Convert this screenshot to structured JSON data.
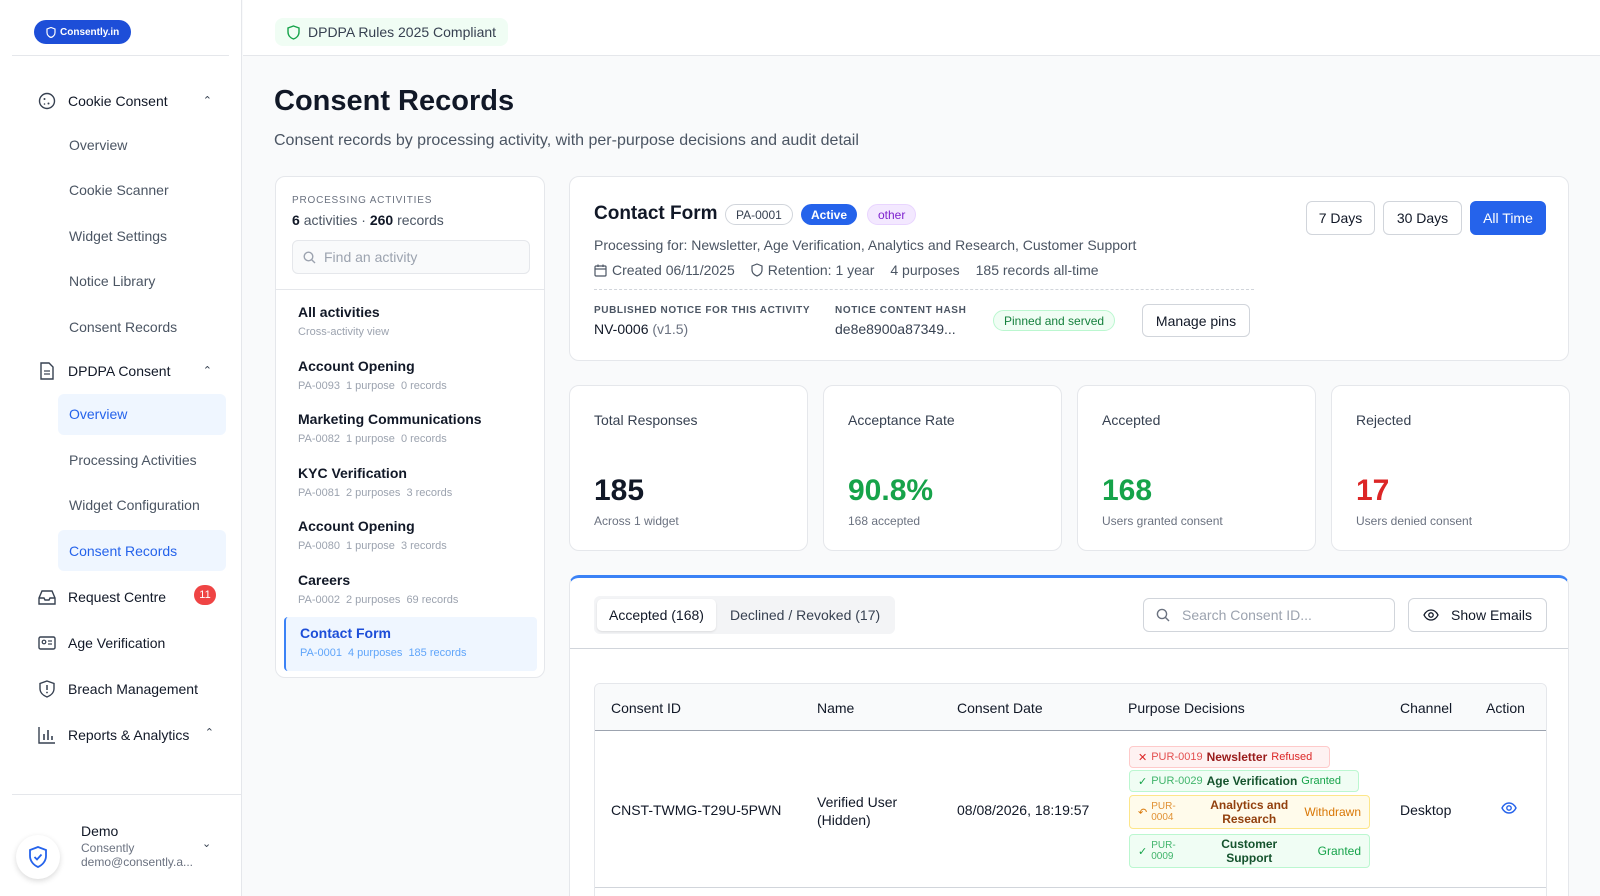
{
  "brand": {
    "logo_text": "Consently.in"
  },
  "sidebar": {
    "groups": [
      {
        "label": "Cookie Consent",
        "items": [
          "Overview",
          "Cookie Scanner",
          "Widget Settings",
          "Notice Library",
          "Consent Records"
        ]
      },
      {
        "label": "DPDPA Consent",
        "items": [
          "Overview",
          "Processing Activities",
          "Widget Configuration",
          "Consent Records"
        ]
      }
    ],
    "request_centre": {
      "label": "Request Centre",
      "badge": "11"
    },
    "age_verification": "Age Verification",
    "breach_management": "Breach Management",
    "reports": "Reports & Analytics",
    "user": {
      "name": "Demo",
      "org": "Consently",
      "email": "demo@consently.a..."
    }
  },
  "topbar": {
    "compliance_label": "DPDPA Rules 2025 Compliant"
  },
  "page": {
    "title": "Consent Records",
    "subtitle": "Consent records by processing activity, with per-purpose decisions and audit detail"
  },
  "activities": {
    "header_label": "PROCESSING ACTIVITIES",
    "count_activities": "6",
    "count_activities_suffix": "activities ·",
    "count_records": "260",
    "count_records_suffix": "records",
    "search_placeholder": "Find an activity",
    "all": {
      "name": "All activities",
      "meta": "Cross-activity view"
    },
    "items": [
      {
        "name": "Account Opening",
        "id": "PA-0093",
        "purposes": "1 purpose",
        "records": "0 records"
      },
      {
        "name": "Marketing Communications",
        "id": "PA-0082",
        "purposes": "1 purpose",
        "records": "0 records"
      },
      {
        "name": "KYC Verification",
        "id": "PA-0081",
        "purposes": "2 purposes",
        "records": "3 records"
      },
      {
        "name": "Account Opening",
        "id": "PA-0080",
        "purposes": "1 purpose",
        "records": "3 records"
      },
      {
        "name": "Careers",
        "id": "PA-0002",
        "purposes": "2 purposes",
        "records": "69 records"
      },
      {
        "name": "Contact Form",
        "id": "PA-0001",
        "purposes": "4 purposes",
        "records": "185 records"
      }
    ]
  },
  "detail": {
    "title": "Contact Form",
    "id": "PA-0001",
    "status": "Active",
    "category": "other",
    "purposes_line": "Processing for: Newsletter, Age Verification, Analytics and Research, Customer Support",
    "created": "Created 06/11/2025",
    "retention": "Retention: 1 year",
    "purposes_count": "4 purposes",
    "records_all_time": "185 records all-time",
    "notice_label": "PUBLISHED NOTICE FOR THIS ACTIVITY",
    "notice_id": "NV-0006",
    "notice_version": "(v1.5)",
    "hash_label": "NOTICE CONTENT HASH",
    "hash_value": "de8e8900a87349...",
    "pinned_label": "Pinned and served",
    "manage_pins": "Manage pins",
    "ranges": [
      "7 Days",
      "30 Days",
      "All Time"
    ],
    "selected_range": "All Time"
  },
  "stats": [
    {
      "label": "Total Responses",
      "value": "185",
      "sub": "Across 1 widget"
    },
    {
      "label": "Acceptance Rate",
      "value": "90.8%",
      "sub": "168 accepted"
    },
    {
      "label": "Accepted",
      "value": "168",
      "sub": "Users granted consent"
    },
    {
      "label": "Rejected",
      "value": "17",
      "sub": "Users denied consent"
    }
  ],
  "records": {
    "tabs": [
      "Accepted (168)",
      "Declined / Revoked (17)"
    ],
    "search_placeholder": "Search Consent ID...",
    "show_emails": "Show Emails",
    "columns": [
      "Consent ID",
      "Name",
      "Consent Date",
      "Purpose Decisions",
      "Channel",
      "Action"
    ],
    "rows": [
      {
        "consent_id": "CNST-TWMG-T29U-5PWN",
        "name": "Verified User (Hidden)",
        "date": "08/08/2026, 18:19:57",
        "channel": "Desktop",
        "decisions": [
          {
            "id": "PUR-0019",
            "name": "Newsletter",
            "state": "Refused"
          },
          {
            "id": "PUR-0029",
            "name": "Age Verification",
            "state": "Granted"
          },
          {
            "id": "PUR-0004",
            "name": "Analytics and Research",
            "state": "Withdrawn"
          },
          {
            "id": "PUR-0009",
            "name": "Customer Support",
            "state": "Granted"
          }
        ]
      }
    ]
  },
  "colors": {
    "accent": "#2563eb",
    "success": "#16a34a",
    "danger": "#dc2626",
    "warning": "#d97706"
  }
}
